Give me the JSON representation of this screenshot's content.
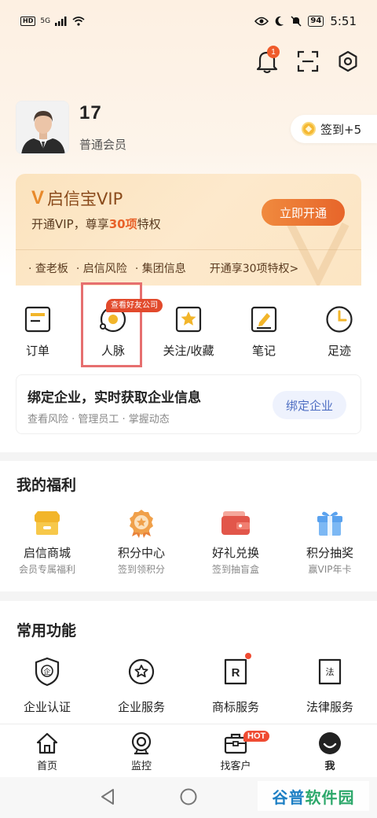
{
  "status_bar": {
    "hd": "HD",
    "signal": "5G",
    "battery": "94",
    "time": "5:51"
  },
  "header": {
    "notification_count": "1"
  },
  "profile": {
    "username": "17",
    "member_level": "普通会员",
    "signin_label": "签到+5"
  },
  "vip": {
    "logo_mark": "V",
    "logo_text": "启信宝VIP",
    "subtitle_pre": "开通VIP，尊享",
    "subtitle_num": "30项",
    "subtitle_post": "特权",
    "button": "立即开通",
    "features": [
      "· 查老板",
      "· 启信风险",
      "· 集团信息"
    ],
    "more": "开通享30项特权>"
  },
  "quick_actions": [
    {
      "label": "订单",
      "icon": "order-icon"
    },
    {
      "label": "人脉",
      "icon": "contacts-icon"
    },
    {
      "label": "关注/收藏",
      "icon": "star-icon"
    },
    {
      "label": "笔记",
      "icon": "note-icon"
    },
    {
      "label": "足迹",
      "icon": "clock-icon"
    }
  ],
  "contacts_tag": "查看好友公司",
  "bind_card": {
    "title": "绑定企业，实时获取企业信息",
    "subtitle": "查看风险 · 管理员工 · 掌握动态",
    "button": "绑定企业"
  },
  "welfare": {
    "title": "我的福利",
    "items": [
      {
        "label": "启信商城",
        "sub": "会员专属福利",
        "icon": "shop-icon"
      },
      {
        "label": "积分中心",
        "sub": "签到领积分",
        "icon": "medal-icon"
      },
      {
        "label": "好礼兑换",
        "sub": "签到抽盲盒",
        "icon": "wallet-icon"
      },
      {
        "label": "积分抽奖",
        "sub": "赢VIP年卡",
        "icon": "gift-icon"
      }
    ]
  },
  "common": {
    "title": "常用功能",
    "items": [
      {
        "label": "企业认证",
        "glyph": "企",
        "icon": "shield-icon"
      },
      {
        "label": "企业服务",
        "glyph": "★",
        "icon": "service-icon"
      },
      {
        "label": "商标服务",
        "glyph": "R",
        "icon": "trademark-icon"
      },
      {
        "label": "法律服务",
        "glyph": "法",
        "icon": "law-icon"
      }
    ]
  },
  "bottom_nav": [
    {
      "label": "首页",
      "icon": "home-icon"
    },
    {
      "label": "监控",
      "icon": "camera-icon"
    },
    {
      "label": "找客户",
      "icon": "briefcase-icon"
    },
    {
      "label": "我",
      "icon": "profile-icon"
    }
  ],
  "hot_badge": "HOT",
  "watermark": {
    "part1": "谷普",
    "part2": "软件园"
  },
  "colors": {
    "accent": "#e8622a",
    "brand_orange": "#f08a3e",
    "icon_yellow": "#f2b52a",
    "highlight_box": "#e66f6f"
  }
}
